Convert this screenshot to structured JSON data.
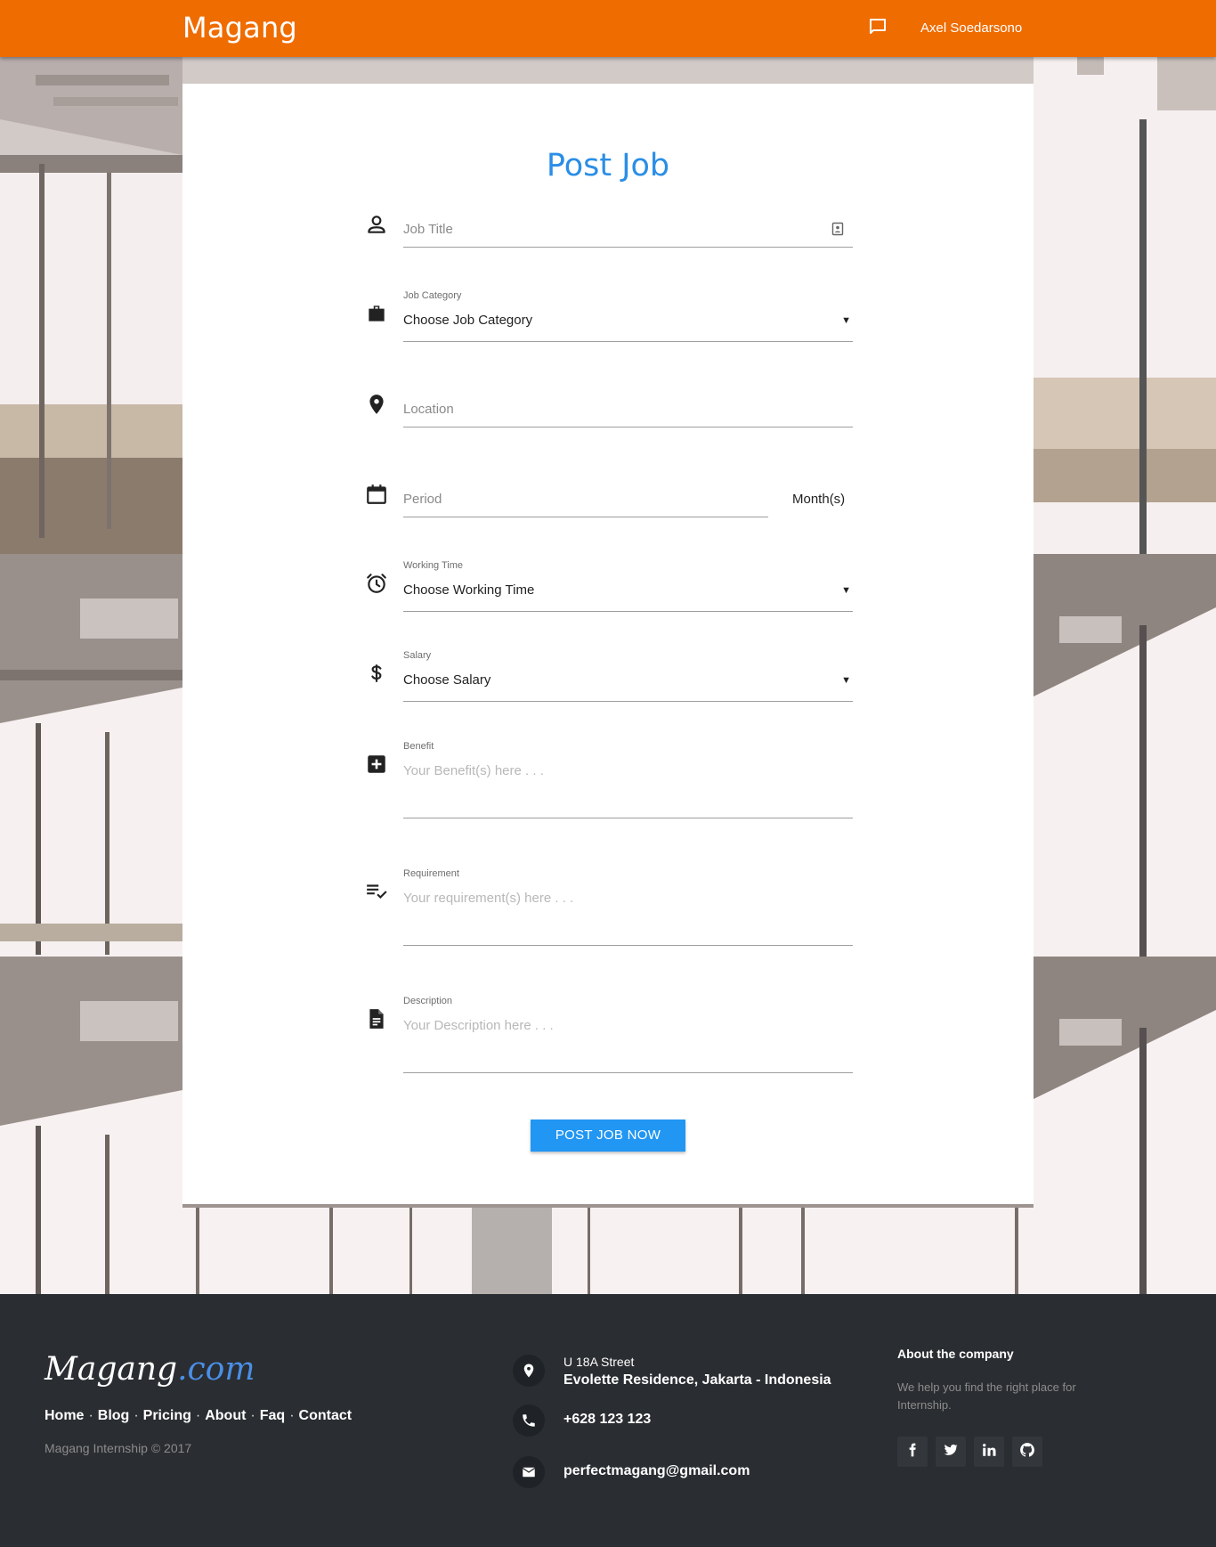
{
  "navbar": {
    "brand": "Magang",
    "user_name": "Axel Soedarsono"
  },
  "form": {
    "title": "Post Job",
    "job_title": {
      "placeholder": "Job Title"
    },
    "job_category": {
      "label": "Job Category",
      "value": "Choose Job Category"
    },
    "location": {
      "placeholder": "Location"
    },
    "period": {
      "placeholder": "Period",
      "unit": "Month(s)"
    },
    "working_time": {
      "label": "Working Time",
      "value": "Choose Working Time"
    },
    "salary": {
      "label": "Salary",
      "value": "Choose Salary"
    },
    "benefit": {
      "label": "Benefit",
      "placeholder": "Your Benefit(s) here . . ."
    },
    "requirement": {
      "label": "Requirement",
      "placeholder": "Your requirement(s) here . . ."
    },
    "description": {
      "label": "Description",
      "placeholder": "Your Description here . . ."
    },
    "submit_label": "POST JOB NOW",
    "caret": "▼"
  },
  "footer": {
    "logo_main": "Magang",
    "logo_suffix": ".com",
    "links": [
      "Home",
      "Blog",
      "Pricing",
      "About",
      "Faq",
      "Contact"
    ],
    "separator": "·",
    "copyright": "Magang Internship © 2017",
    "address_line1": "U 18A Street",
    "address_line2": "Evolette Residence, Jakarta - Indonesia",
    "phone": "+628 123 123",
    "email": "perfectmagang@gmail.com",
    "about_title": "About the company",
    "about_text": "We help you find the right place for Internship."
  },
  "colors": {
    "navbar": "#ef6c00",
    "title": "#2a8ee6",
    "button": "#2196f3",
    "footer": "#2a2d31"
  }
}
